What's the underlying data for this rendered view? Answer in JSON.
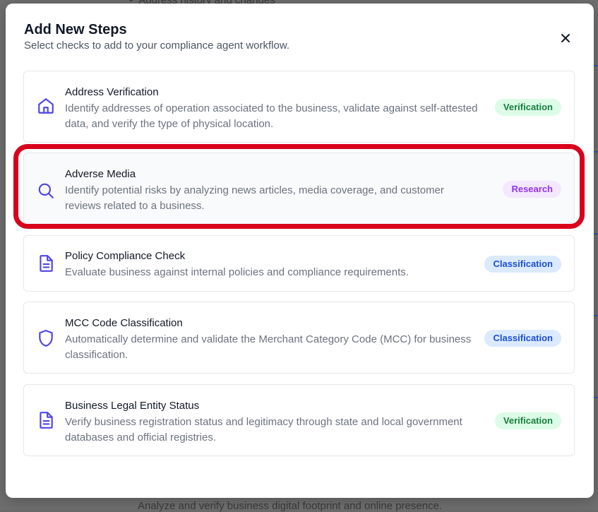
{
  "background": {
    "top_text": "Address history and changes",
    "bottom_text": "Analyze and verify business digital footprint and online presence."
  },
  "modal": {
    "title": "Add New Steps",
    "subtitle": "Select checks to add to your compliance agent workflow.",
    "close_icon": "close-icon"
  },
  "steps": [
    {
      "title": "Address Verification",
      "description": "Identify addresses of operation associated to the business, validate against self-attested data, and verify the type of physical location.",
      "badge": "Verification",
      "icon": "home-icon"
    },
    {
      "title": "Adverse Media",
      "description": "Identify potential risks by analyzing news articles, media coverage, and customer reviews related to a business.",
      "badge": "Research",
      "icon": "search-icon"
    },
    {
      "title": "Policy Compliance Check",
      "description": "Evaluate business against internal policies and compliance requirements.",
      "badge": "Classification",
      "icon": "document-icon"
    },
    {
      "title": "MCC Code Classification",
      "description": "Automatically determine and validate the Merchant Category Code (MCC) for business classification.",
      "badge": "Classification",
      "icon": "shield-icon"
    },
    {
      "title": "Business Legal Entity Status",
      "description": "Verify business registration status and legitimacy through state and local government databases and official registries.",
      "badge": "Verification",
      "icon": "document-icon"
    }
  ],
  "colors": {
    "icon": "#4f46e5",
    "highlight": "#d9001b",
    "verification_bg": "#dcfce7",
    "verification_fg": "#15803d",
    "research_bg": "#f3e8ff",
    "research_fg": "#9333ea",
    "classification_bg": "#dbeafe",
    "classification_fg": "#1d4ed8"
  }
}
